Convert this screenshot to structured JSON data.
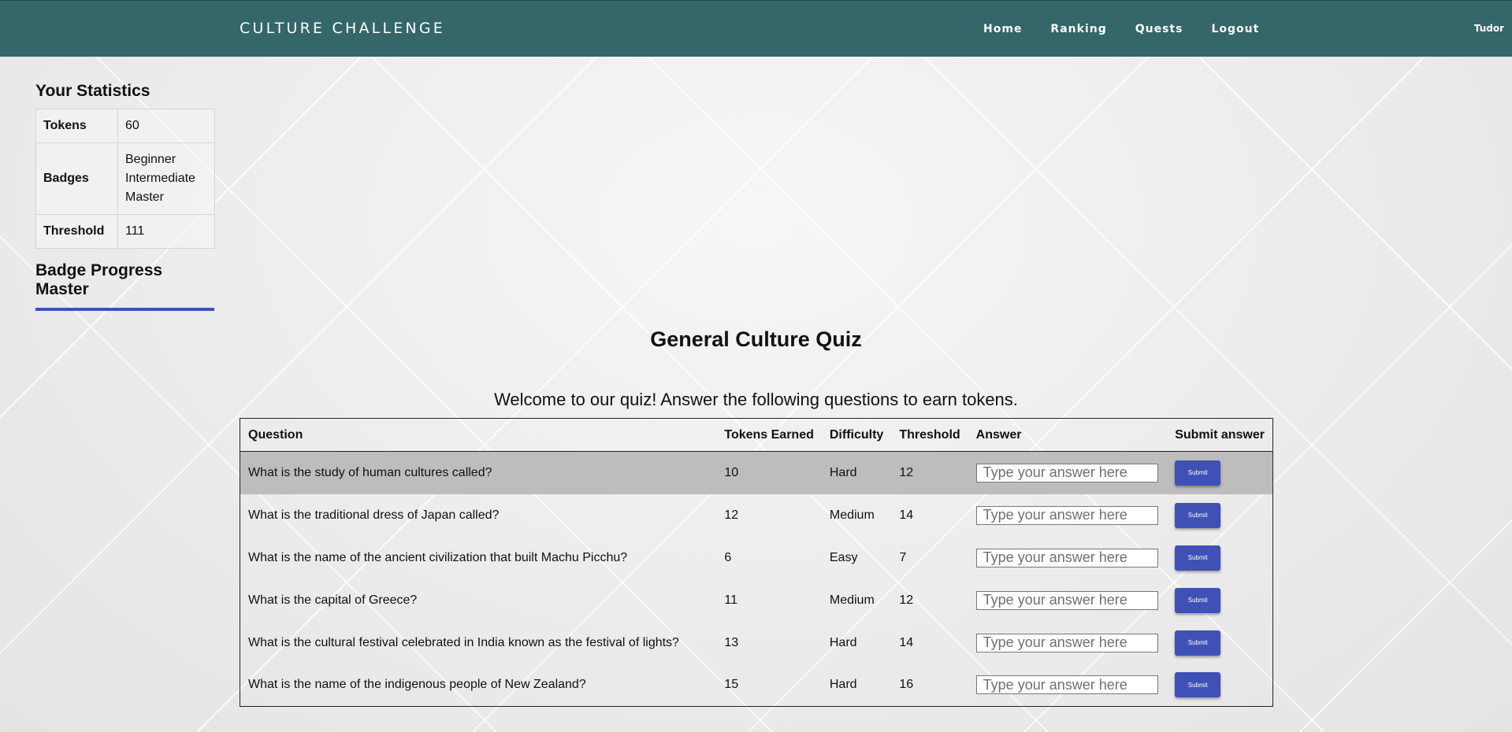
{
  "navbar": {
    "brand": "CULTURE CHALLENGE",
    "links": [
      "Home",
      "Ranking",
      "Quests",
      "Logout"
    ],
    "user": "Tudor"
  },
  "stats": {
    "title": "Your Statistics",
    "tokens_label": "Tokens",
    "tokens_value": "60",
    "badges_label": "Badges",
    "badges": [
      "Beginner",
      "Intermediate",
      "Master"
    ],
    "threshold_label": "Threshold",
    "threshold_value": "111"
  },
  "badge_progress": {
    "title": "Badge Progress Master",
    "progress": 1.0
  },
  "quiz": {
    "title": "General Culture Quiz",
    "intro": "Welcome to our quiz! Answer the following questions to earn tokens.",
    "headers": [
      "Question",
      "Tokens Earned",
      "Difficulty",
      "Threshold",
      "Answer",
      "Submit answer"
    ],
    "answer_placeholder": "Type your answer here",
    "submit_label": "Submit",
    "rows": [
      {
        "question": "What is the study of human cultures called?",
        "tokens": "10",
        "difficulty": "Hard",
        "threshold": "12"
      },
      {
        "question": "What is the traditional dress of Japan called?",
        "tokens": "12",
        "difficulty": "Medium",
        "threshold": "14"
      },
      {
        "question": "What is the name of the ancient civilization that built Machu Picchu?",
        "tokens": "6",
        "difficulty": "Easy",
        "threshold": "7"
      },
      {
        "question": "What is the capital of Greece?",
        "tokens": "11",
        "difficulty": "Medium",
        "threshold": "12"
      },
      {
        "question": "What is the cultural festival celebrated in India known as the festival of lights?",
        "tokens": "13",
        "difficulty": "Hard",
        "threshold": "14"
      },
      {
        "question": "What is the name of the indigenous people of New Zealand?",
        "tokens": "15",
        "difficulty": "Hard",
        "threshold": "16"
      }
    ]
  }
}
